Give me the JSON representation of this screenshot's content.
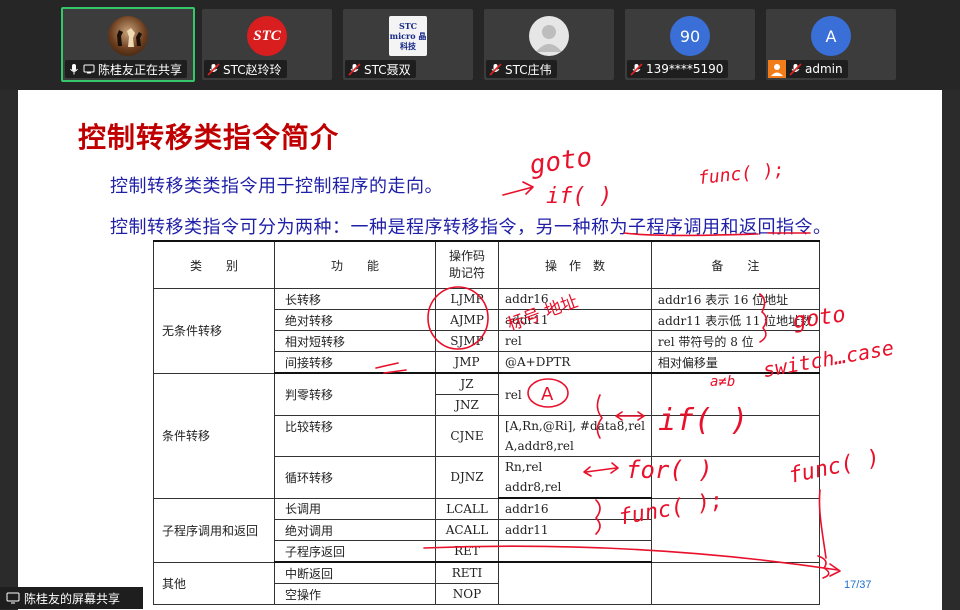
{
  "participants": [
    {
      "name": "陈桂友正在共享",
      "avatar": "chess-photo",
      "active": true,
      "mic": "on"
    },
    {
      "name": "STC赵玲玲",
      "avatar": "STC",
      "avatar_color": "#e02020",
      "mic": "muted"
    },
    {
      "name": "STC聂双",
      "avatar": "STC micro 晶科技",
      "avatar_color": "#f4f4f4",
      "mic": "muted"
    },
    {
      "name": "STC庄伟",
      "avatar": "person-icon",
      "avatar_color": "#e8e8e8",
      "mic": "muted"
    },
    {
      "name": "139****5190",
      "avatar": "90",
      "avatar_color": "#3a6fd8",
      "mic": "muted"
    },
    {
      "name": "admin",
      "avatar": "A",
      "avatar_color": "#3a6fd8",
      "mic": "muted",
      "host": true
    }
  ],
  "slide": {
    "title": "控制转移类指令简介",
    "line1": "控制转移类类指令用于控制程序的走向。",
    "line2": "控制转移类指令可分为两种：一种是程序转移指令，另一种称为子程序调用和返回指令。",
    "page": "17/37",
    "table": {
      "headers": {
        "type": "类　　别",
        "func": "功　　能",
        "mn1": "操作码",
        "mn2": "助记符",
        "op": "操　作　数",
        "note": "备　　注"
      },
      "groups": {
        "g1": "无条件转移",
        "g2": "条件转移",
        "g3": "子程序调用和返回",
        "g4": "其他"
      },
      "rows": [
        {
          "func": "长转移",
          "mn": "LJMP",
          "op": "addr16",
          "note": "addr16 表示 16 位地址"
        },
        {
          "func": "绝对转移",
          "mn": "AJMP",
          "op": "addr11",
          "note": "addr11 表示低 11 位地址数"
        },
        {
          "func": "相对短转移",
          "mn": "SJMP",
          "op": "rel",
          "note": "rel 带符号的 8 位"
        },
        {
          "func": "间接转移",
          "mn": "JMP",
          "op": "@A+DPTR",
          "note": "相对偏移量"
        },
        {
          "func": "判零转移",
          "mn": "JZ",
          "mn2": "JNZ",
          "op": "rel"
        },
        {
          "func": "比较转移",
          "mn": "CJNE",
          "op": "[A,Rn,@Ri], #data8,rel",
          "op2": "A,addr8,rel"
        },
        {
          "func": "循环转移",
          "mn": "DJNZ",
          "op": "Rn,rel",
          "op2": "addr8,rel"
        },
        {
          "func": "长调用",
          "mn": "LCALL",
          "op": "addr16"
        },
        {
          "func": "绝对调用",
          "mn": "ACALL",
          "op": "addr11"
        },
        {
          "func": "子程序返回",
          "mn": "RET"
        },
        {
          "func": "中断返回",
          "mn": "RETI"
        },
        {
          "func": "空操作",
          "mn": "NOP"
        }
      ]
    },
    "handwriting": {
      "goto_top": "goto",
      "if_top": "if( )",
      "func_top": "func( );",
      "note_near_addr": "标号 地址",
      "goto_right": "goto",
      "switch_case": "switch…case",
      "A_circle": "A",
      "if_cond": "a≠b",
      "if_right": "if( )",
      "for_right": "for( )",
      "func_right": "func( );",
      "func_call_right": "func( )"
    },
    "ink_color": "#e8102a"
  },
  "share_label": "陈桂友的屏幕共享"
}
